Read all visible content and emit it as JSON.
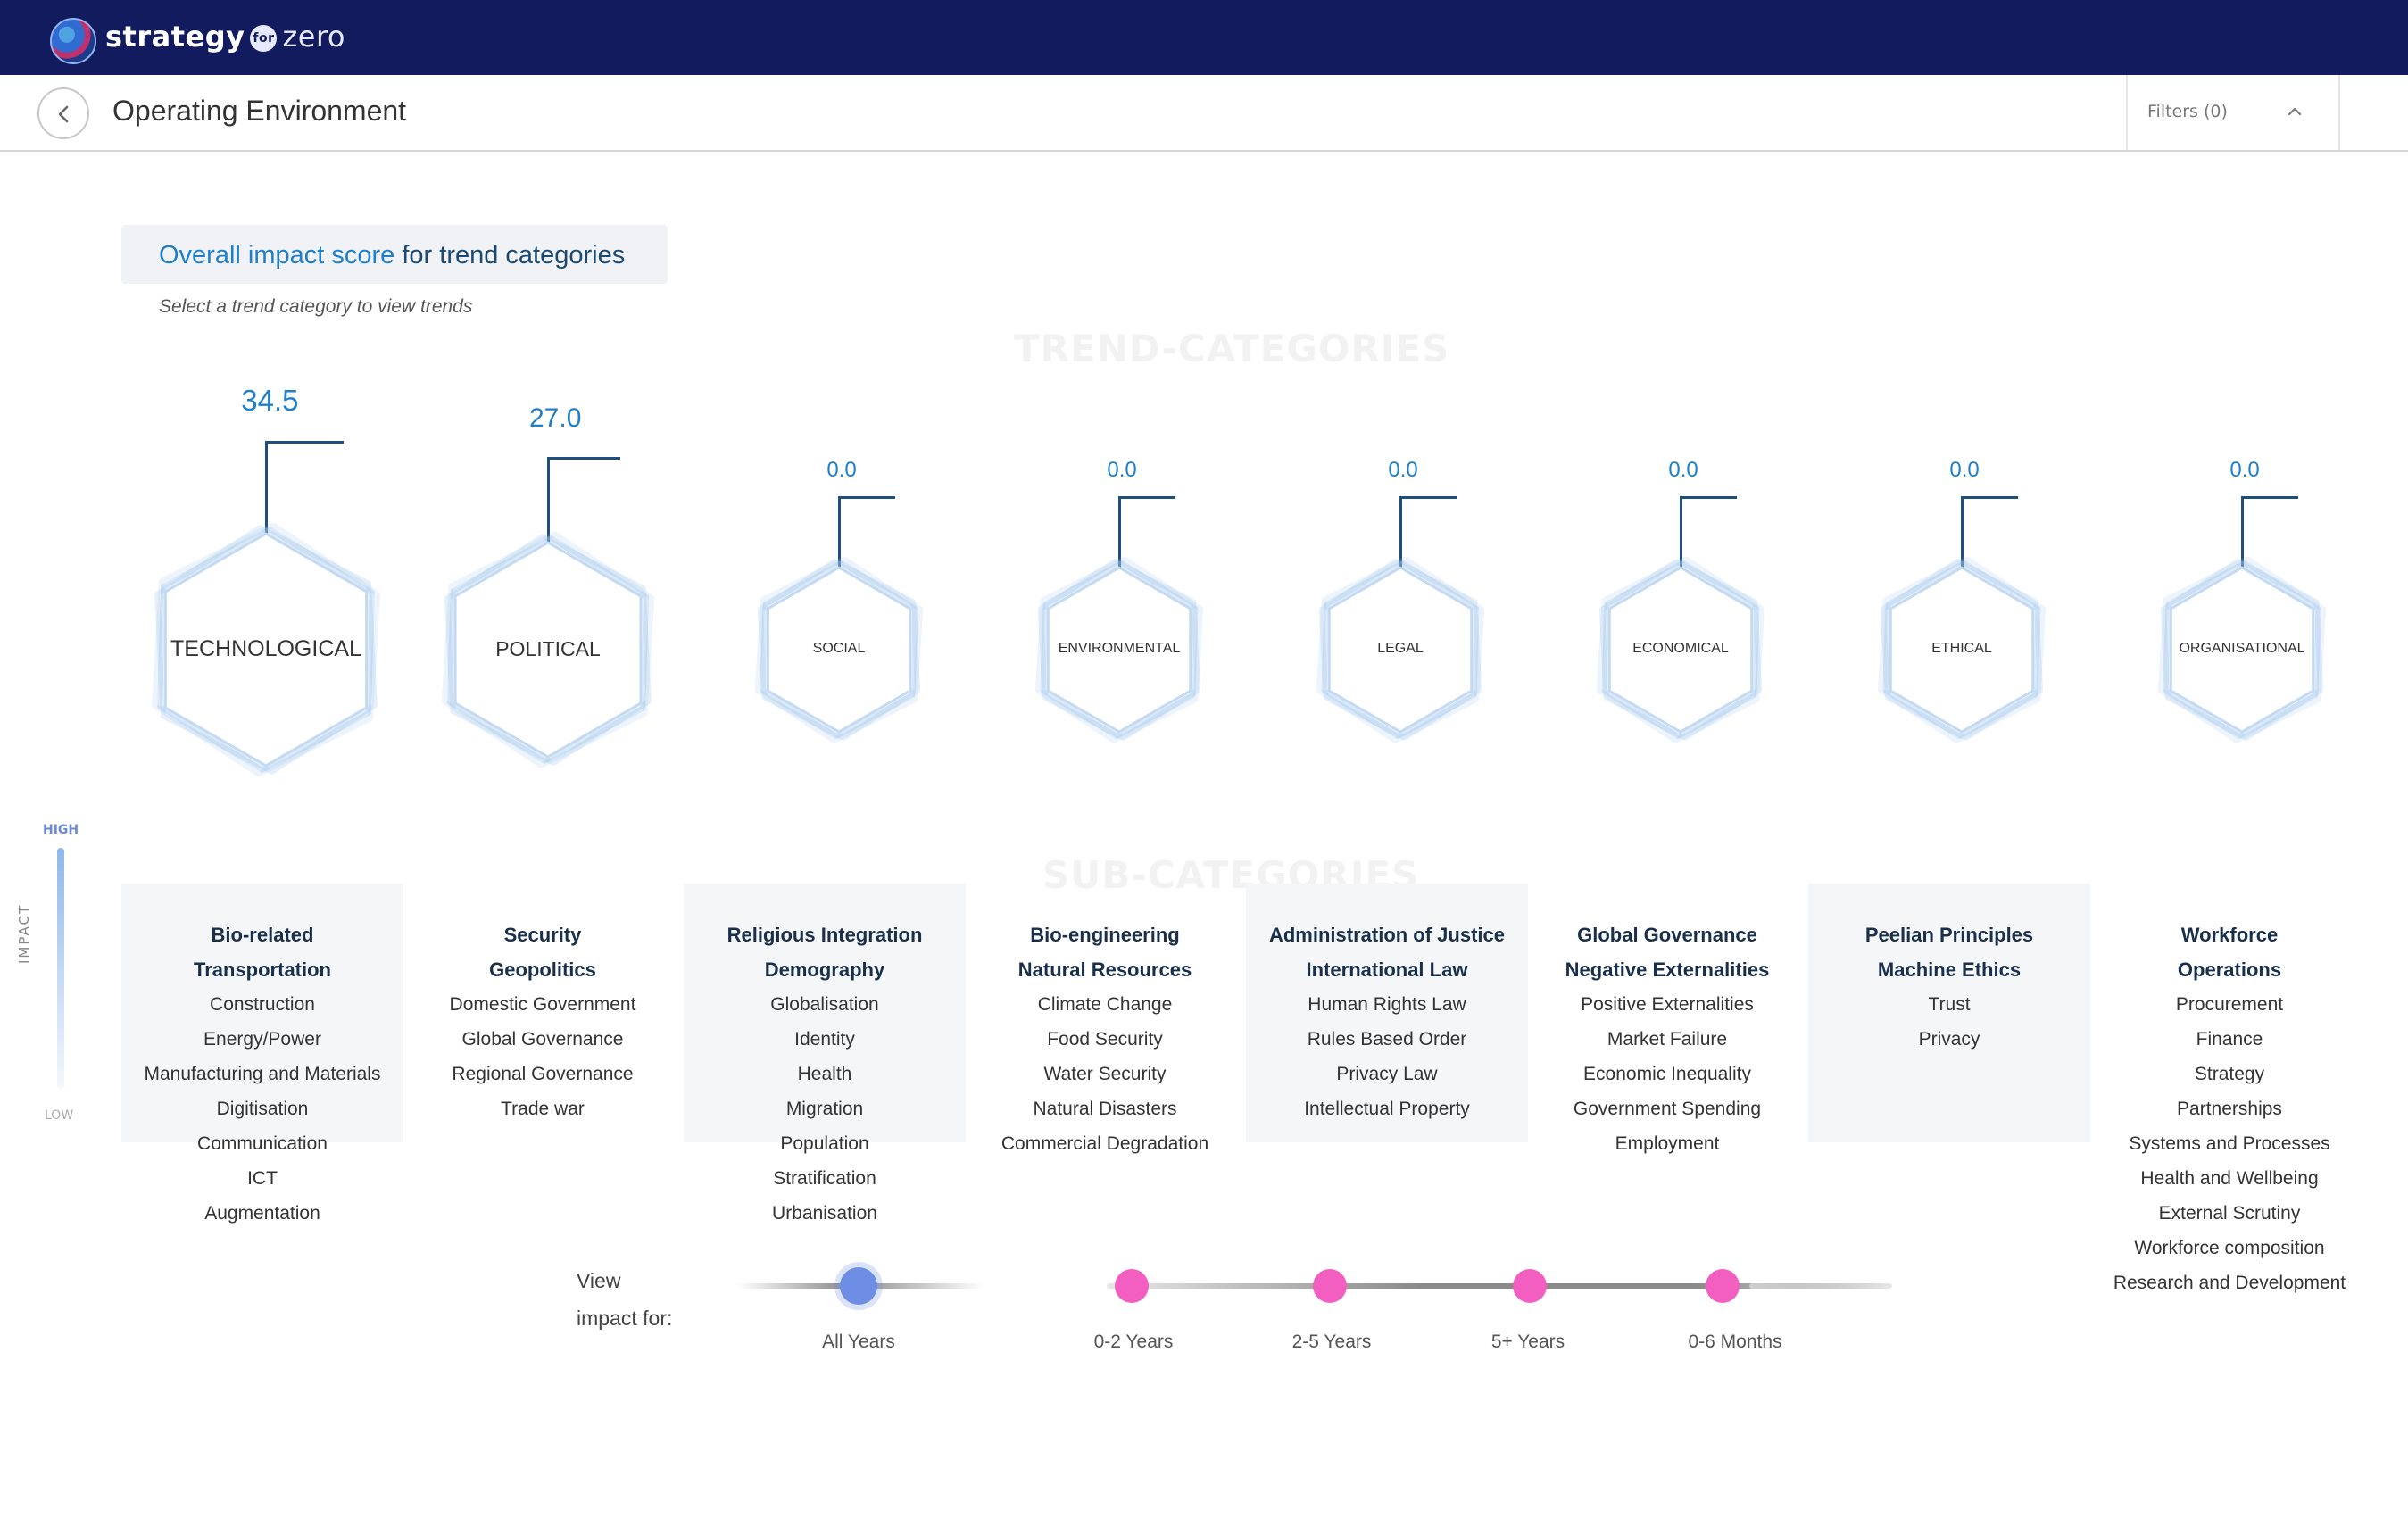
{
  "app": {
    "brand_primary": "strategy",
    "brand_for": "for",
    "brand_secondary": "zero",
    "bar_color": "#131b5f"
  },
  "header": {
    "title": "Operating Environment",
    "filters_label": "Filters (0)"
  },
  "intro": {
    "title_accent": "Overall impact score",
    "title_rest": " for trend categories",
    "subtitle": "Select a trend category to view trends"
  },
  "sections": {
    "trend_categories": "TREND-CATEGORIES",
    "sub_categories": "SUB-CATEGORIES"
  },
  "categories": [
    {
      "name": "TECHNOLOGICAL",
      "score": "34.5"
    },
    {
      "name": "POLITICAL",
      "score": "27.0"
    },
    {
      "name": "SOCIAL",
      "score": "0.0"
    },
    {
      "name": "ENVIRONMENTAL",
      "score": "0.0"
    },
    {
      "name": "LEGAL",
      "score": "0.0"
    },
    {
      "name": "ECONOMICAL",
      "score": "0.0"
    },
    {
      "name": "ETHICAL",
      "score": "0.0"
    },
    {
      "name": "ORGANISATIONAL",
      "score": "0.0"
    }
  ],
  "impact_legend": {
    "high": "HIGH",
    "label": "IMPACT",
    "low": "LOW"
  },
  "subcategories": [
    {
      "bold": [
        "Bio-related",
        "Transportation"
      ],
      "items": [
        "Construction",
        "Energy/Power",
        "Manufacturing and Materials",
        "Digitisation",
        "Communication",
        "ICT",
        "Augmentation"
      ],
      "bold_extra": [
        "Digitisation"
      ]
    },
    {
      "bold": [
        "Security",
        "Geopolitics"
      ],
      "items": [
        "Domestic Government",
        "Global Governance",
        "Regional Governance",
        "Trade war"
      ]
    },
    {
      "bold": [
        "Religious Integration",
        "Demography"
      ],
      "items": [
        "Globalisation",
        "Identity",
        "Health",
        "Migration",
        "Population",
        "Stratification",
        "Urbanisation"
      ]
    },
    {
      "bold": [
        "Bio-engineering",
        "Natural Resources"
      ],
      "items": [
        "Climate Change",
        "Food Security",
        "Water Security",
        "Natural Disasters",
        "Commercial Degradation"
      ]
    },
    {
      "bold": [
        "Administration of Justice",
        "International Law"
      ],
      "items": [
        "Human Rights Law",
        "Rules Based Order",
        "Privacy Law",
        "Intellectual Property"
      ]
    },
    {
      "bold": [
        "Global Governance",
        "Negative Externalities"
      ],
      "items": [
        "Positive Externalities",
        "Market Failure",
        "Economic Inequality",
        "Government Spending",
        "Employment"
      ]
    },
    {
      "bold": [
        "Peelian Principles",
        "Machine Ethics"
      ],
      "items": [
        "Trust",
        "Privacy"
      ]
    },
    {
      "bold": [
        "Workforce",
        "Operations"
      ],
      "items": [
        "Procurement",
        "Finance",
        "Strategy",
        "Partnerships",
        "Systems and Processes",
        "Health and Wellbeing",
        "External Scrutiny",
        "Workforce composition",
        "Research and Development"
      ]
    }
  ],
  "timeline": {
    "label_line1": "View",
    "label_line2": "impact for:",
    "options": [
      {
        "label": "All Years",
        "active": true
      },
      {
        "label": "0-2 Years",
        "active": false
      },
      {
        "label": "2-5 Years",
        "active": false
      },
      {
        "label": "5+ Years",
        "active": false
      },
      {
        "label": "0-6 Months",
        "active": false
      }
    ],
    "active_color": "#6e8ee6",
    "inactive_color": "#f25fc0"
  }
}
